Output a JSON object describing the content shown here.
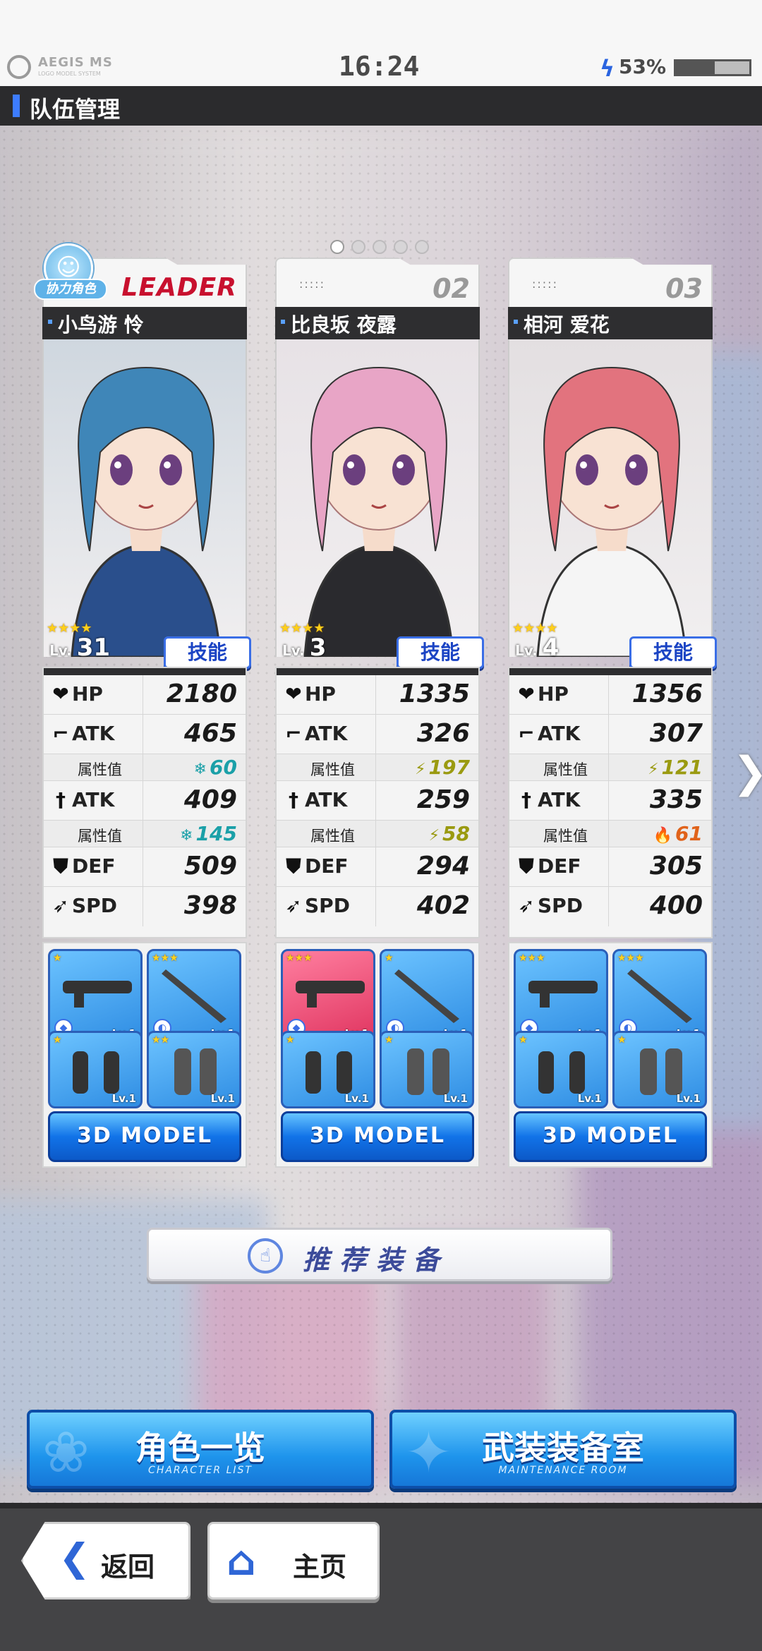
{
  "status": {
    "brand": "AEGIS MS",
    "brand_sub": "LOGO MODEL SYSTEM",
    "time": "16:24",
    "battery": "53%",
    "battery_level": 0.53
  },
  "header": {
    "title": "队伍管理"
  },
  "pager": {
    "count": 5,
    "active": 0
  },
  "cards": [
    {
      "tag": "LEADER",
      "badge": "协力角色",
      "name": "小鸟游 怜",
      "stars": "★★★★",
      "lv_prefix": "Lv.",
      "lv": "31",
      "skill": "技能",
      "hp_label": "HP",
      "hp": "2180",
      "atk1_label": "ATK",
      "atk1": "465",
      "attr_label": "属性值",
      "attr1": "60",
      "attr1_icon": "❄",
      "attr1_color": "#1aa0a8",
      "atk2_label": "ATK",
      "atk2": "409",
      "attr2": "145",
      "attr2_icon": "❄",
      "attr2_color": "#1aa0a8",
      "def_label": "DEF",
      "def": "509",
      "spd_label": "SPD",
      "spd": "398",
      "equip_lv": [
        "Lv.1",
        "Lv.1",
        "Lv.1",
        "Lv.1"
      ],
      "equip_stars": [
        "★",
        "★★★",
        "★",
        "★★"
      ],
      "model": "3D MODEL",
      "hair": "#3f86b8",
      "outfit": "#2a4f8c",
      "bg": "#cfd7df"
    },
    {
      "tag": "02",
      "name": "比良坂 夜露",
      "stars": "★★★★",
      "lv_prefix": "Lv.",
      "lv": "3",
      "skill": "技能",
      "hp_label": "HP",
      "hp": "1335",
      "atk1_label": "ATK",
      "atk1": "326",
      "attr_label": "属性值",
      "attr1": "197",
      "attr1_icon": "⚡",
      "attr1_color": "#9a9a10",
      "atk2_label": "ATK",
      "atk2": "259",
      "attr2": "58",
      "attr2_icon": "⚡",
      "attr2_color": "#9a9a10",
      "def_label": "DEF",
      "def": "294",
      "spd_label": "SPD",
      "spd": "402",
      "equip_lv": [
        "Lv.1",
        "Lv.1",
        "Lv.1",
        "Lv.1"
      ],
      "equip_stars": [
        "★★★",
        "★",
        "★",
        "★"
      ],
      "model": "3D MODEL",
      "hair": "#e8a5c6",
      "outfit": "#2a2a2e",
      "bg": "#e7e2e6"
    },
    {
      "tag": "03",
      "name": "相河 爱花",
      "stars": "★★★★",
      "lv_prefix": "Lv.",
      "lv": "4",
      "skill": "技能",
      "hp_label": "HP",
      "hp": "1356",
      "atk1_label": "ATK",
      "atk1": "307",
      "attr_label": "属性值",
      "attr1": "121",
      "attr1_icon": "⚡",
      "attr1_color": "#9a9a10",
      "atk2_label": "ATK",
      "atk2": "335",
      "attr2": "61",
      "attr2_icon": "🔥",
      "attr2_color": "#e0621a",
      "def_label": "DEF",
      "def": "305",
      "spd_label": "SPD",
      "spd": "400",
      "equip_lv": [
        "Lv.1",
        "Lv.1",
        "Lv.1",
        "Lv.1"
      ],
      "equip_stars": [
        "★★★",
        "★★★",
        "★",
        "★"
      ],
      "model": "3D MODEL",
      "hair": "#e2737e",
      "outfit": "#f5f5f5",
      "bg": "#e3dfe1"
    }
  ],
  "recommend": {
    "label": "推荐装备"
  },
  "buttons": {
    "character_list": {
      "zh": "角色一览",
      "en": "CHARACTER LIST"
    },
    "maintenance": {
      "zh": "武装装备室",
      "en": "MAINTENANCE ROOM"
    }
  },
  "nav": {
    "back": "返回",
    "home": "主页"
  }
}
